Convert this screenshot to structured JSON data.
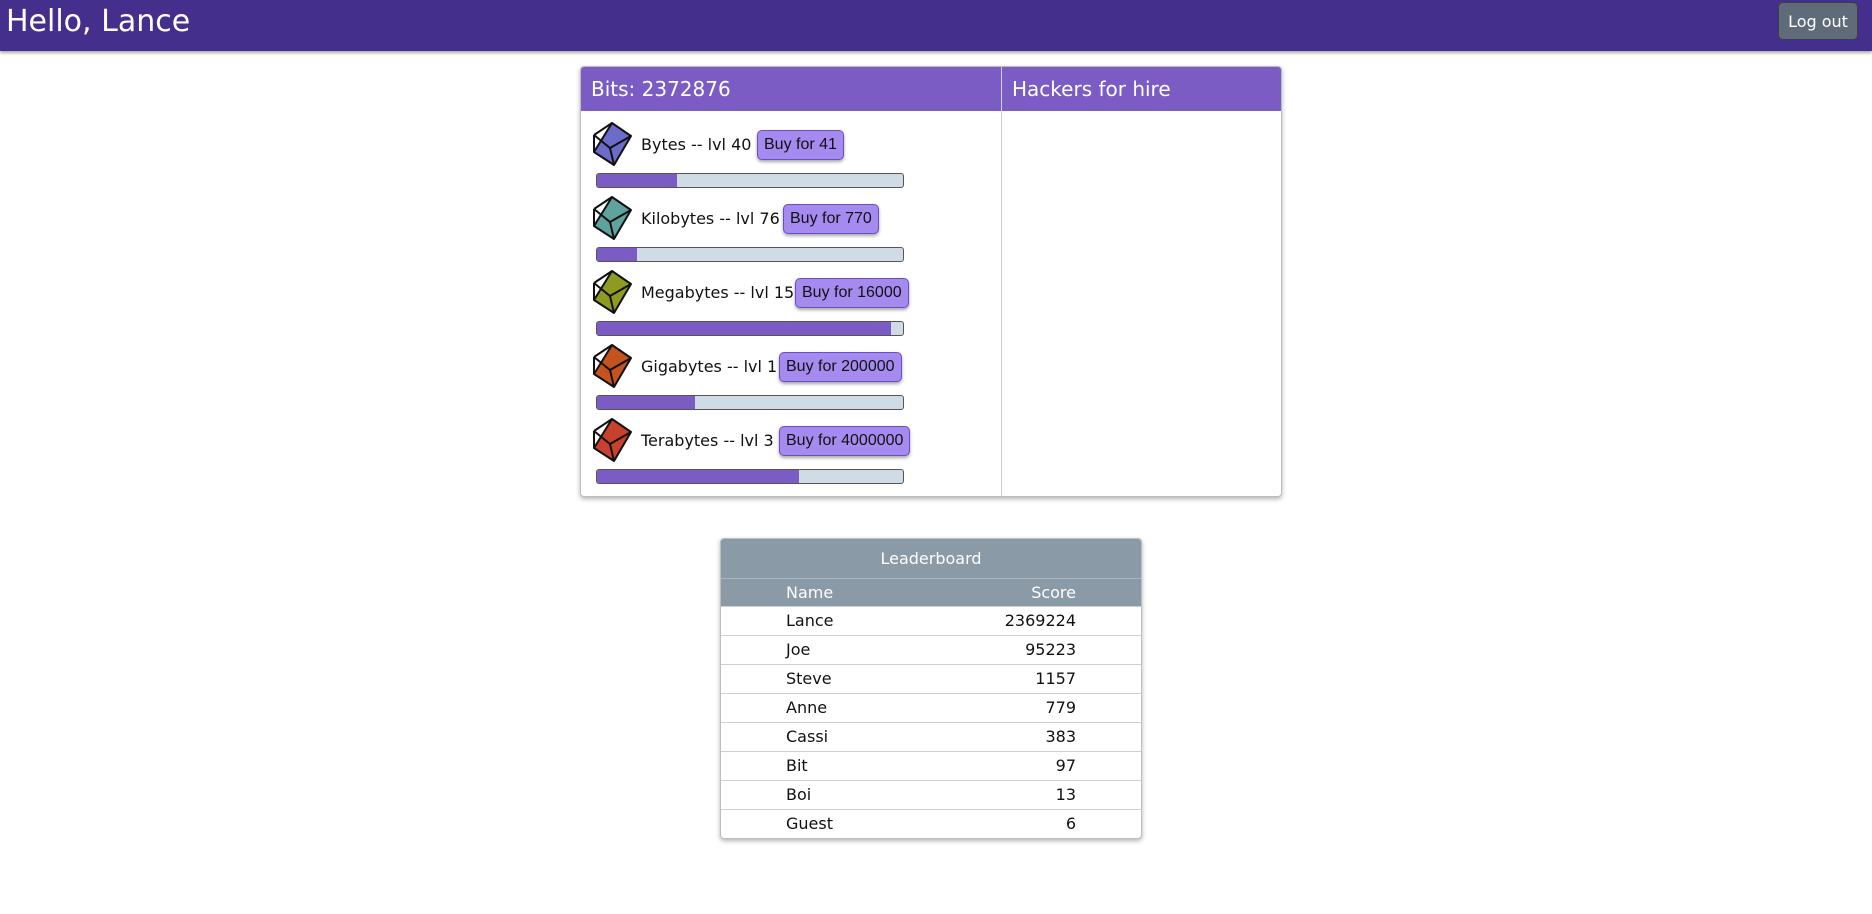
{
  "header": {
    "greeting": "Hello, Lance",
    "logout_label": "Log out"
  },
  "game": {
    "bits_title": "Bits: 2372876",
    "hackers_title": "Hackers for hire",
    "items": [
      {
        "label": "Bytes -- lvl 40",
        "buy": "Buy for 41",
        "progress": 0.26,
        "color": "#6b6bc9"
      },
      {
        "label": "Kilobytes -- lvl 76",
        "buy": "Buy for 770",
        "progress": 0.13,
        "color": "#5fa39e"
      },
      {
        "label": "Megabytes -- lvl 15",
        "buy": "Buy for 16000",
        "progress": 0.96,
        "color": "#8f9a22"
      },
      {
        "label": "Gigabytes -- lvl 1",
        "buy": "Buy for 200000",
        "progress": 0.32,
        "color": "#c5531f"
      },
      {
        "label": "Terabytes -- lvl 3",
        "buy": "Buy for 4000000",
        "progress": 0.66,
        "color": "#c8412d"
      }
    ]
  },
  "leaderboard": {
    "title": "Leaderboard",
    "columns": {
      "name": "Name",
      "score": "Score"
    },
    "rows": [
      {
        "name": "Lance",
        "score": "2369224"
      },
      {
        "name": "Joe",
        "score": "95223"
      },
      {
        "name": "Steve",
        "score": "1157"
      },
      {
        "name": "Anne",
        "score": "779"
      },
      {
        "name": "Cassi",
        "score": "383"
      },
      {
        "name": "Bit",
        "score": "97"
      },
      {
        "name": "Boi",
        "score": "13"
      },
      {
        "name": "Guest",
        "score": "6"
      }
    ]
  }
}
